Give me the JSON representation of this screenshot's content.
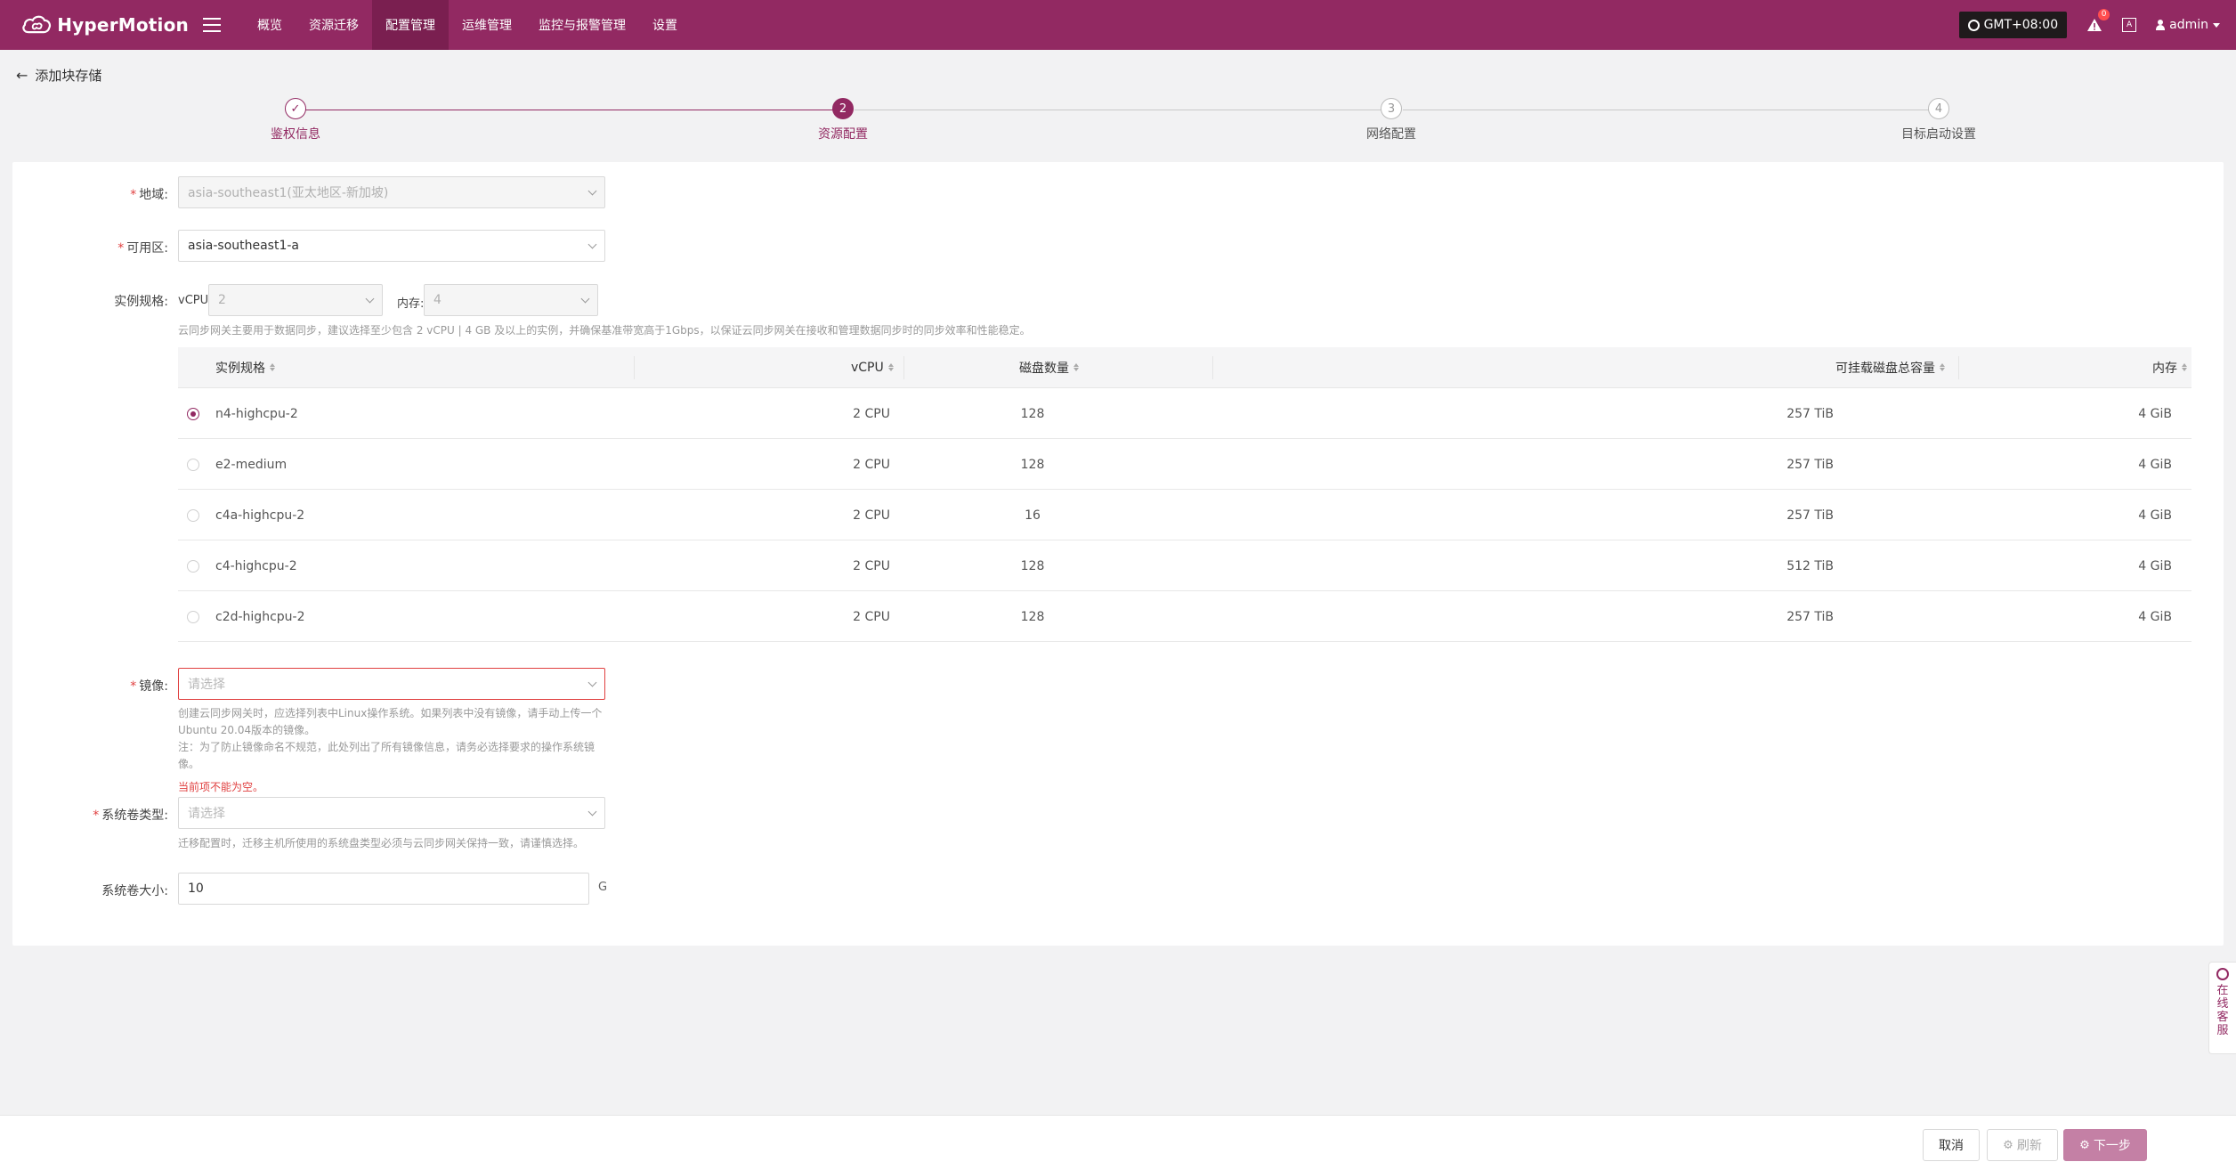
{
  "app": {
    "name": "HyperMotion"
  },
  "nav": {
    "items": [
      {
        "label": "概览"
      },
      {
        "label": "资源迁移"
      },
      {
        "label": "配置管理"
      },
      {
        "label": "运维管理"
      },
      {
        "label": "监控与报警管理"
      },
      {
        "label": "设置"
      }
    ],
    "active_index": 2,
    "timezone": "GMT+08:00",
    "notification_count": "0",
    "lang_icon_text": "A",
    "user": "admin"
  },
  "page": {
    "back_title": "添加块存储"
  },
  "steps": [
    {
      "number": "1",
      "label": "鉴权信息",
      "status": "done"
    },
    {
      "number": "2",
      "label": "资源配置",
      "status": "active"
    },
    {
      "number": "3",
      "label": "网络配置",
      "status": "pending"
    },
    {
      "number": "4",
      "label": "目标启动设置",
      "status": "pending"
    }
  ],
  "form": {
    "region": {
      "label": "地域:",
      "value": "asia-southeast1(亚太地区-新加坡)"
    },
    "zone": {
      "label": "可用区:",
      "value": "asia-southeast1-a"
    },
    "spec": {
      "label": "实例规格:",
      "vcpu_label": "vCPU:",
      "vcpu_value": "2",
      "mem_label": "内存:",
      "mem_value": "4",
      "hint": "云同步网关主要用于数据同步，建议选择至少包含 2 vCPU | 4 GB 及以上的实例，并确保基准带宽高于1Gbps，以保证云同步网关在接收和管理数据同步时的同步效率和性能稳定。"
    },
    "image": {
      "label": "镜像:",
      "placeholder": "请选择",
      "hint_lines": [
        "创建云同步网关时，应选择列表中Linux操作系统。如果列表中没有镜像，请手动上传一个",
        "Ubuntu 20.04版本的镜像。",
        "注：为了防止镜像命名不规范，此处列出了所有镜像信息，请务必选择要求的操作系统镜",
        "像。"
      ],
      "error": "当前项不能为空。"
    },
    "disk_type": {
      "label": "系统卷类型:",
      "placeholder": "请选择",
      "hint": "迁移配置时，迁移主机所使用的系统盘类型必须与云同步网关保持一致，请谨慎选择。"
    },
    "disk_size": {
      "label": "系统卷大小:",
      "value": "10",
      "unit": "G"
    }
  },
  "table": {
    "headers": [
      "实例规格",
      "vCPU",
      "磁盘数量",
      "可挂载磁盘总容量",
      "内存"
    ],
    "selected_index": 0,
    "rows": [
      {
        "name": "n4-highcpu-2",
        "vcpu": "2 CPU",
        "disks": "128",
        "capacity": "257 TiB",
        "memory": "4 GiB"
      },
      {
        "name": "e2-medium",
        "vcpu": "2 CPU",
        "disks": "128",
        "capacity": "257 TiB",
        "memory": "4 GiB"
      },
      {
        "name": "c4a-highcpu-2",
        "vcpu": "2 CPU",
        "disks": "16",
        "capacity": "257 TiB",
        "memory": "4 GiB"
      },
      {
        "name": "c4-highcpu-2",
        "vcpu": "2 CPU",
        "disks": "128",
        "capacity": "512 TiB",
        "memory": "4 GiB"
      },
      {
        "name": "c2d-highcpu-2",
        "vcpu": "2 CPU",
        "disks": "128",
        "capacity": "257 TiB",
        "memory": "4 GiB"
      }
    ]
  },
  "footer": {
    "cancel": "取消",
    "refresh": "刷新",
    "next": "下一步"
  },
  "service": {
    "label": "在线客服"
  },
  "colors": {
    "brand": "#922962",
    "error": "#e04040"
  }
}
